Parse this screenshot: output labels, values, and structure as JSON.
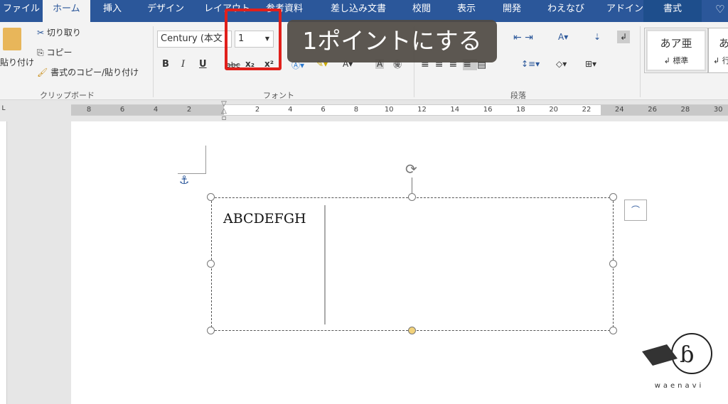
{
  "tabs": [
    "ファイル",
    "ホーム",
    "挿入",
    "デザイン",
    "レイアウト",
    "参考資料",
    "差し込み文書",
    "校閲",
    "表示",
    "開発",
    "わえなび",
    "アドイン",
    "書式"
  ],
  "tell_me_icon": "lightbulb-icon",
  "clipboard": {
    "paste": "貼り付け",
    "cut": "切り取り",
    "copy": "コピー",
    "format_painter": "書式のコピー/貼り付け",
    "group": "クリップボード"
  },
  "font": {
    "name": "Century (本文",
    "size": "1",
    "bold": "B",
    "italic": "I",
    "underline": "U",
    "strike": "abc",
    "sub": "x₂",
    "sup": "x²",
    "group": "フォント"
  },
  "paragraph": {
    "group": "段落"
  },
  "styles": [
    {
      "sample": "あア亜",
      "name": "↲ 標準"
    },
    {
      "sample": "あ",
      "name": "↲ 行"
    }
  ],
  "caption": "1ポイントにする",
  "ruler": {
    "left": [
      "8",
      "6",
      "4",
      "2"
    ],
    "right": [
      "2",
      "4",
      "6",
      "8",
      "10",
      "12",
      "14",
      "16",
      "18",
      "20",
      "22",
      "24",
      "26",
      "28",
      "30"
    ]
  },
  "document": {
    "textbox_text": "ABCDEFGH"
  },
  "logo": {
    "text": "waenavi"
  },
  "colors": {
    "ribbon_tab": "#2b579a",
    "highlight_box": "#e0201b"
  }
}
